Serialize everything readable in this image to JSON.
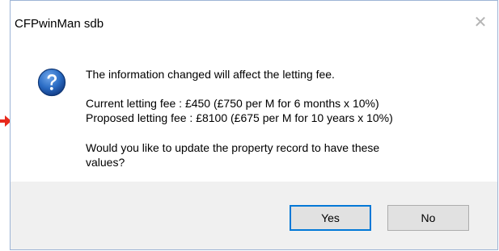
{
  "window": {
    "title": "CFPwinMan sdb",
    "close_glyph": "✕"
  },
  "message": {
    "line1": "The information changed will affect the letting fee.",
    "current_fee": "Current letting fee : £450 (£750 per M for 6 months x 10%)",
    "proposed_fee": "Proposed letting fee : £8100 (£675 per M for 10 years x 10%)",
    "question_line1": "Would you like to update the property record to have these",
    "question_line2": "values?"
  },
  "buttons": {
    "yes": "Yes",
    "no": "No"
  },
  "icons": {
    "message_icon": "question-icon",
    "pointer": "arrow-icon"
  },
  "colors": {
    "accent": "#0078d7",
    "arrow": "#e8291c",
    "icon_blue": "#1f5fb5"
  }
}
